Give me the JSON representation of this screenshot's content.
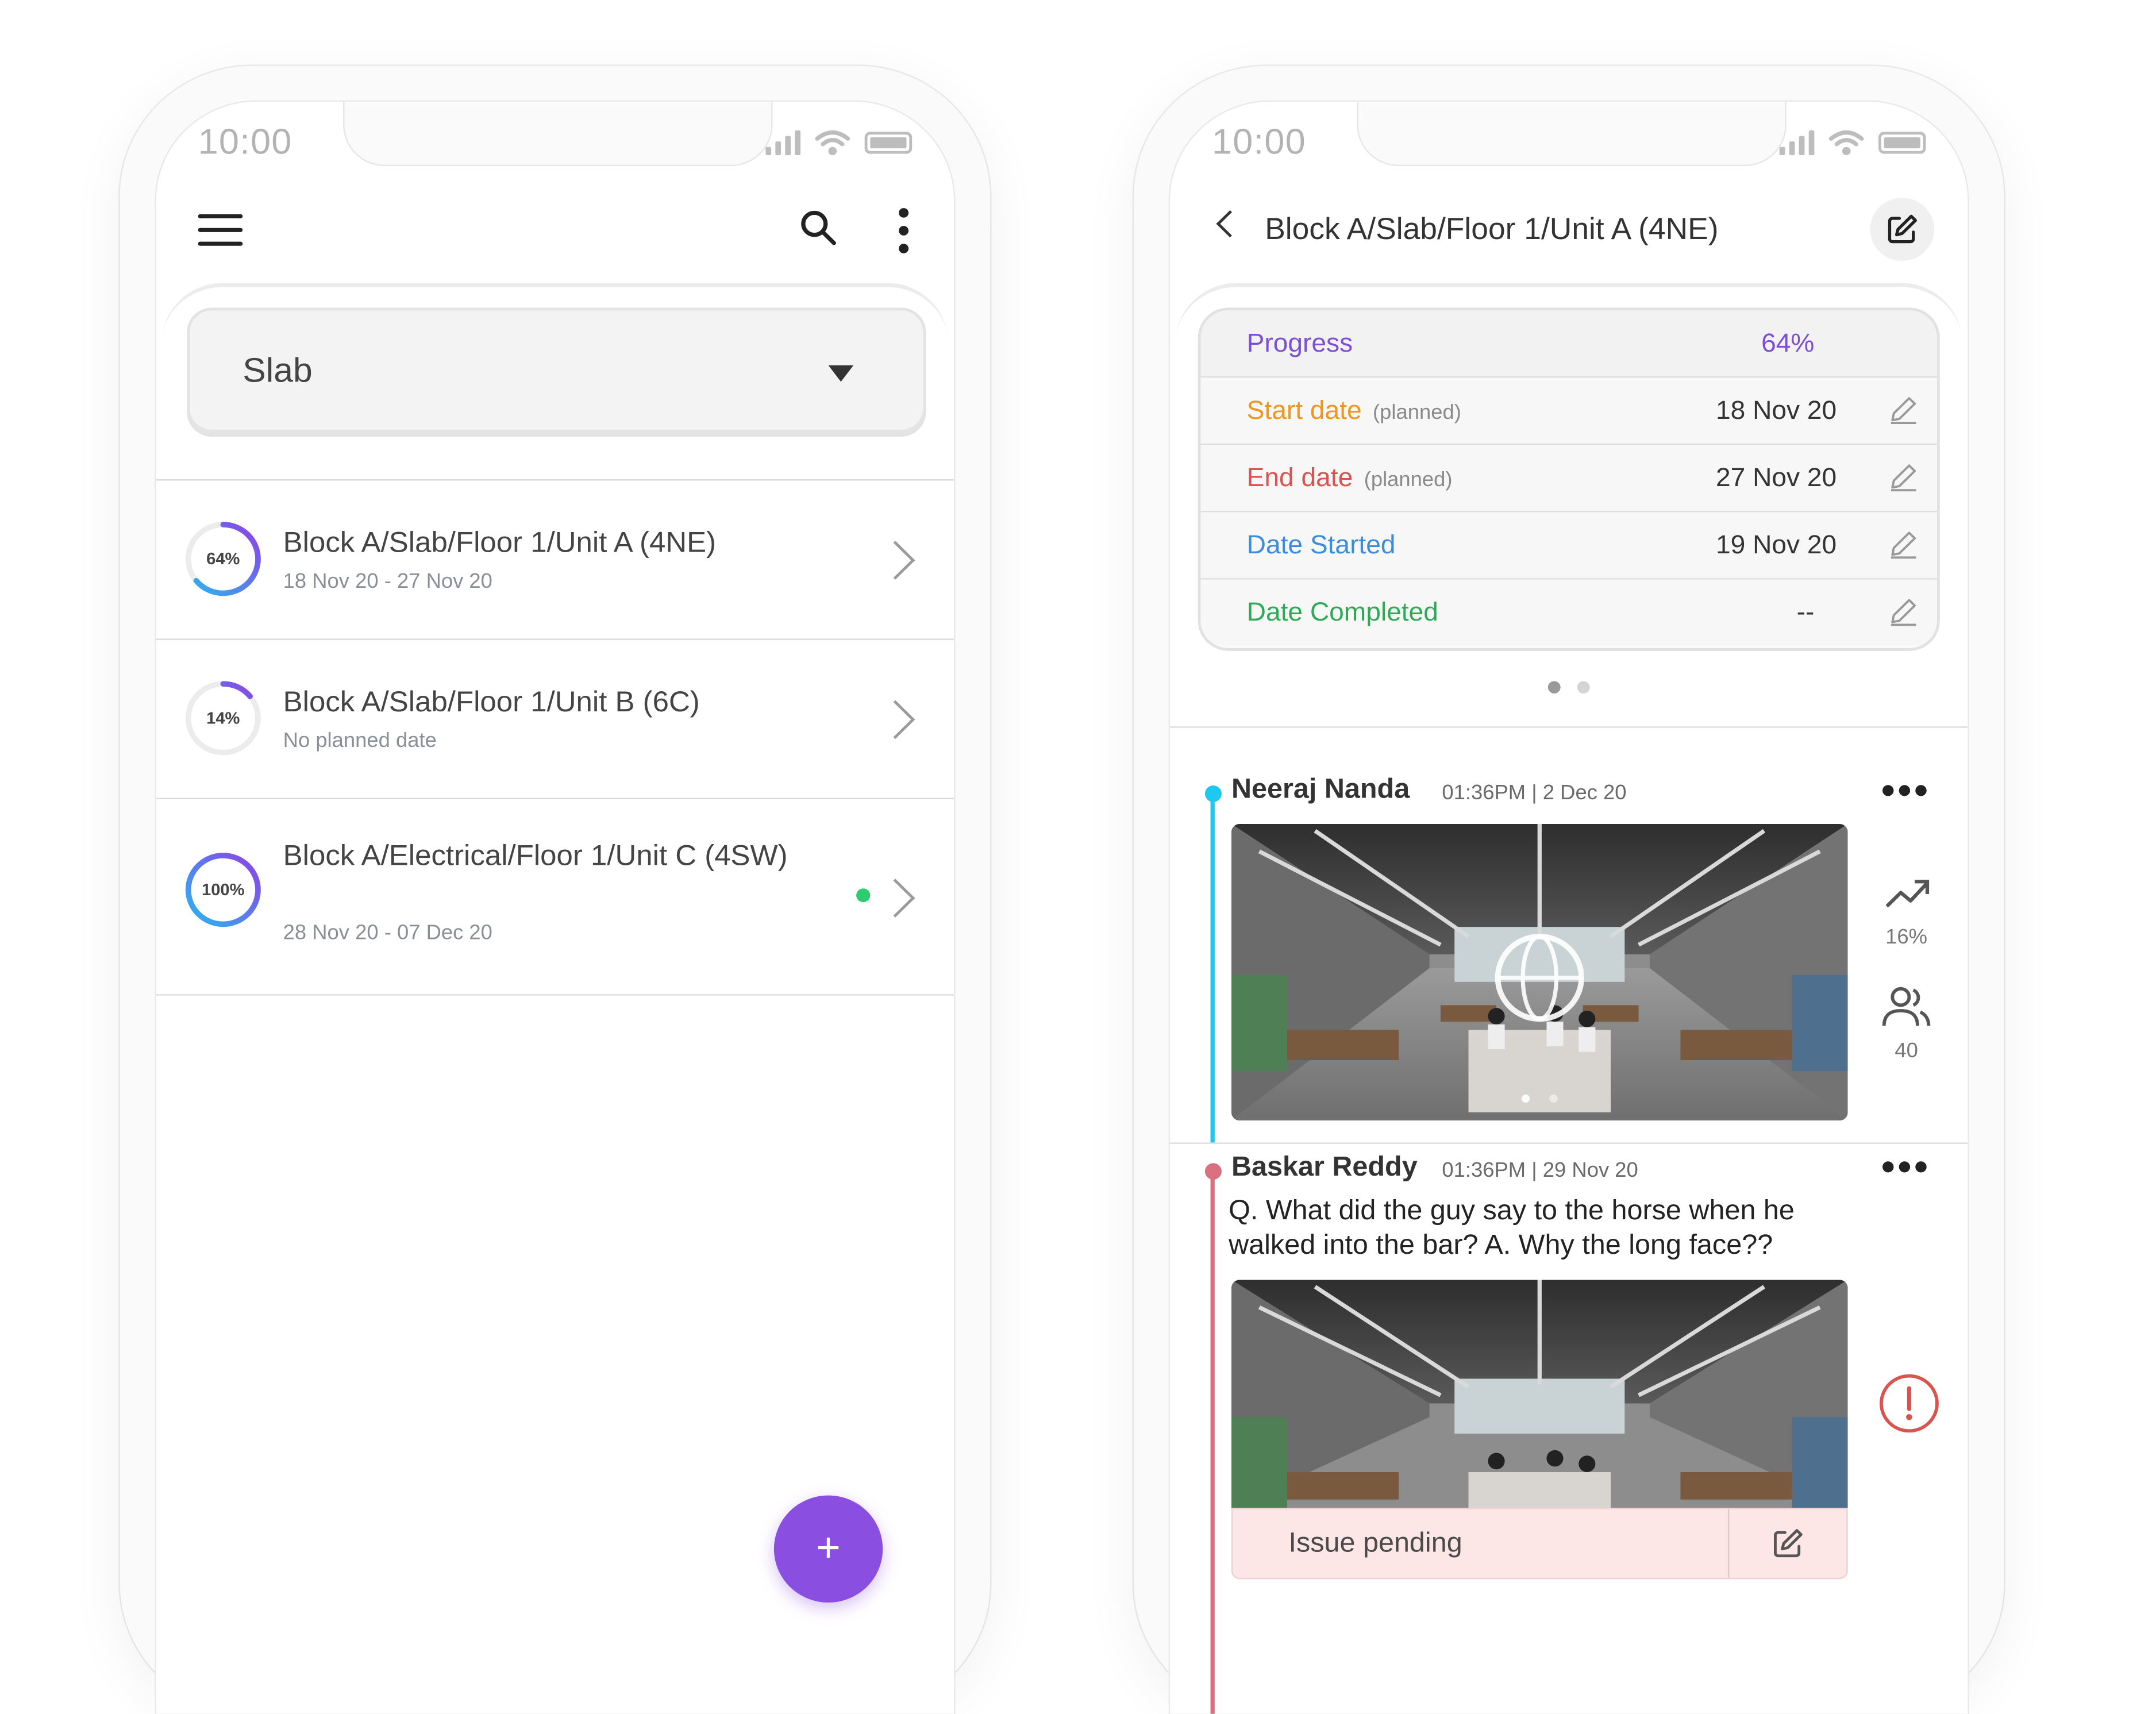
{
  "left_phone": {
    "status": {
      "time": "10:00"
    },
    "header": {
      "menu_icon": "hamburger-icon",
      "search_icon": "search-icon",
      "more_icon": "kebab-icon"
    },
    "filter": {
      "selected": "Slab"
    },
    "items": [
      {
        "progress_label": "64%",
        "progress": 0.64,
        "title": "Block A/Slab/Floor 1/Unit A (4NE)",
        "subtitle": "18 Nov 20 - 27 Nov 20"
      },
      {
        "progress_label": "14%",
        "progress": 0.14,
        "title": "Block A/Slab/Floor 1/Unit B (6C)",
        "subtitle": "No planned date"
      },
      {
        "progress_label": "100%",
        "progress": 1.0,
        "title": "Block A/Electrical/Floor 1/Unit C (4SW)",
        "subtitle": "28 Nov 20 - 07 Dec 20",
        "indicator": "green-dot"
      }
    ],
    "fab_label": "+"
  },
  "right_phone": {
    "status": {
      "time": "10:00"
    },
    "header": {
      "title": "Block A/Slab/Floor 1/Unit A (4NE)"
    },
    "summary": {
      "progress": {
        "label": "Progress",
        "value": "64%"
      },
      "rows": [
        {
          "label": "Start date",
          "note": "(planned)",
          "value": "18 Nov 20",
          "color": "#f0961f"
        },
        {
          "label": "End date",
          "note": "(planned)",
          "value": "27 Nov 20",
          "color": "#d9534f"
        },
        {
          "label": "Date Started",
          "note": "",
          "value": "19 Nov 20",
          "color": "#3a8dde"
        },
        {
          "label": "Date Completed",
          "note": "",
          "value": "--",
          "color": "#2eaa55"
        }
      ]
    },
    "pager": {
      "count": 2,
      "active": 0
    },
    "feed": [
      {
        "author": "Neeraj Nanda",
        "time": "01:36PM | 2 Dec 20",
        "more": "•••",
        "stats": {
          "progress": "16%",
          "people": "40"
        },
        "color": "#1ec8f0"
      },
      {
        "author": "Baskar Reddy",
        "time": "01:36PM | 29 Nov 20",
        "more": "•••",
        "text": "Q. What did the guy say to the horse when he walked into the bar? A. Why the long face??",
        "issue": "Issue pending",
        "color": "#d9707f"
      }
    ]
  },
  "colors": {
    "accent": "#8a4fe0",
    "progress_text": "#7d4fd6",
    "issue_red": "#d9534f"
  }
}
